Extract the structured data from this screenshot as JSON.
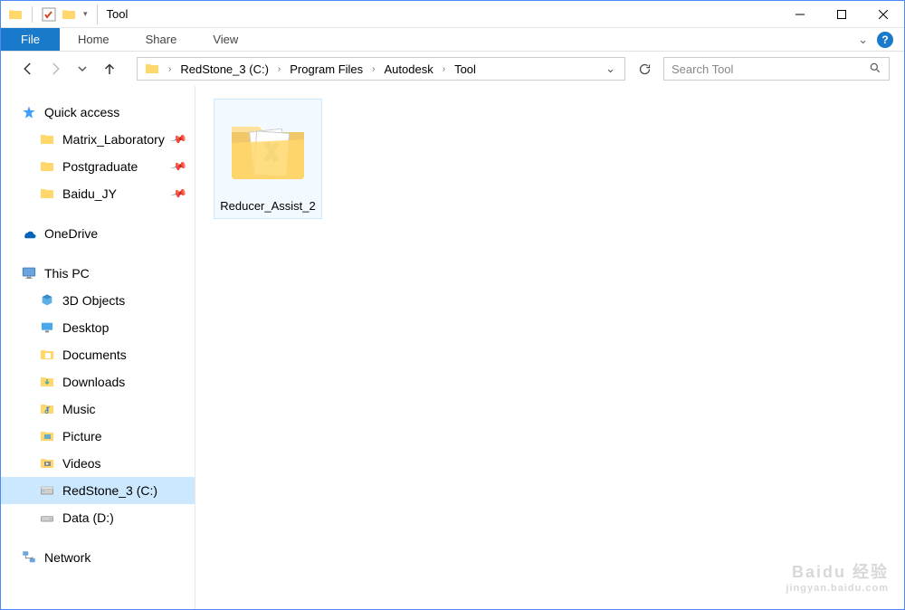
{
  "window": {
    "title": "Tool"
  },
  "ribbon": {
    "file_label": "File",
    "tabs": [
      "Home",
      "Share",
      "View"
    ],
    "help_glyph": "?"
  },
  "breadcrumb": {
    "segments": [
      "RedStone_3 (C:)",
      "Program Files",
      "Autodesk",
      "Tool"
    ]
  },
  "search": {
    "placeholder": "Search Tool"
  },
  "navpane": {
    "quick_access": {
      "label": "Quick access",
      "items": [
        {
          "label": "Matrix_Laboratory",
          "pinned": true
        },
        {
          "label": "Postgraduate",
          "pinned": true
        },
        {
          "label": "Baidu_JY",
          "pinned": true
        }
      ]
    },
    "onedrive": {
      "label": "OneDrive"
    },
    "this_pc": {
      "label": "This PC",
      "items": [
        {
          "label": "3D Objects",
          "icon": "3d"
        },
        {
          "label": "Desktop",
          "icon": "desktop"
        },
        {
          "label": "Documents",
          "icon": "documents"
        },
        {
          "label": "Downloads",
          "icon": "downloads"
        },
        {
          "label": "Music",
          "icon": "music"
        },
        {
          "label": "Picture",
          "icon": "pictures"
        },
        {
          "label": "Videos",
          "icon": "videos"
        },
        {
          "label": "RedStone_3 (C:)",
          "icon": "drive",
          "selected": true
        },
        {
          "label": "Data (D:)",
          "icon": "drive"
        }
      ]
    },
    "network": {
      "label": "Network"
    }
  },
  "files": {
    "items": [
      {
        "label": "Reducer_Assist_2"
      }
    ]
  },
  "watermark": {
    "main": "Baidu 经验",
    "sub": "jingyan.baidu.com"
  }
}
